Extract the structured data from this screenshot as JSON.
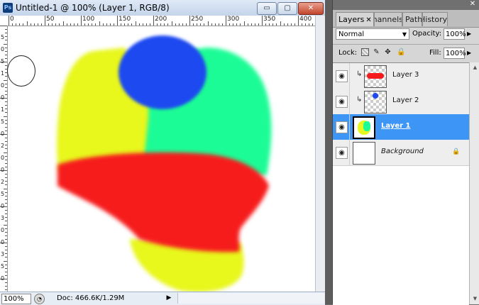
{
  "window": {
    "title": "Untitled-1 @ 100% (Layer 1, RGB/8)",
    "app_icon": "ps-logo-icon",
    "app_icon_text": "Ps",
    "min_label": "▭",
    "max_label": "▢",
    "close_label": "✕"
  },
  "ruler": {
    "labels": [
      "0",
      "50",
      "100",
      "150",
      "200",
      "250",
      "300",
      "350",
      "400"
    ],
    "vertical_labels": [
      "5",
      "0",
      "5",
      "1",
      "0",
      "0",
      "1",
      "5",
      "0",
      "2",
      "0",
      "0",
      "2",
      "5",
      "0",
      "3",
      "0",
      "0",
      "3",
      "5",
      "0"
    ]
  },
  "status": {
    "zoom": "100%",
    "doc": "Doc: 466.6K/1.29M",
    "arrow": "▶"
  },
  "panel": {
    "close_label": "✕",
    "tabs": [
      {
        "label": "Layers",
        "close": "✕"
      },
      {
        "label": "Channels"
      },
      {
        "label": "Paths"
      },
      {
        "label": "History"
      }
    ],
    "blend_mode": "Normal",
    "opacity_label": "Opacity:",
    "opacity": "100%",
    "lock_label": "Lock:",
    "fill_label": "Fill:",
    "fill": "100%",
    "layers": [
      {
        "name": "Layer 3",
        "visible": true,
        "linked": true,
        "selected": false
      },
      {
        "name": "Layer 2",
        "visible": true,
        "linked": true,
        "selected": false
      },
      {
        "name": "Layer 1",
        "visible": true,
        "linked": false,
        "selected": true
      },
      {
        "name": "Background",
        "visible": true,
        "linked": false,
        "selected": false,
        "locked": true
      }
    ]
  },
  "colors": {
    "yellow": "#e8f71f",
    "green": "#1cfc96",
    "blue": "#1f48f0",
    "red": "#f61b1c",
    "selection": "#3d95f5"
  }
}
